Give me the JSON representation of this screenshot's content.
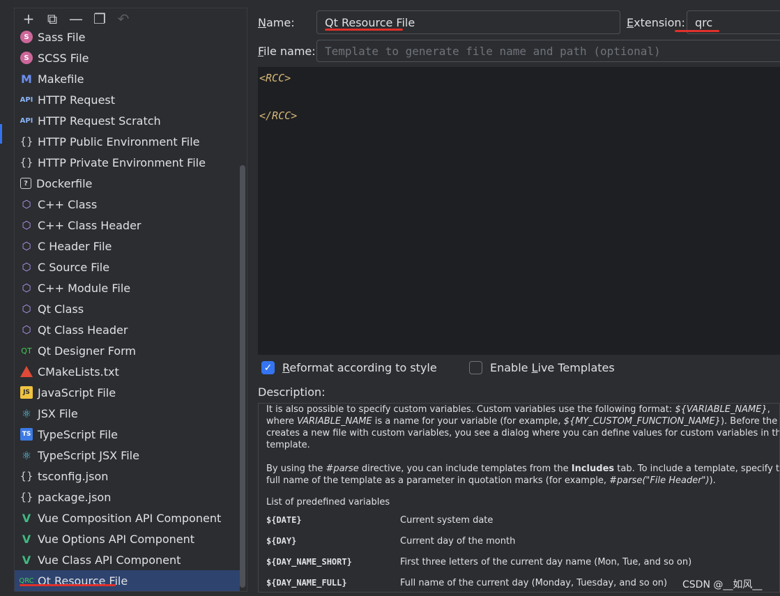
{
  "toolbar": {
    "add": "+",
    "copy": "⧉",
    "remove": "—",
    "duplicate": "❐",
    "undo": "↶"
  },
  "templates": [
    {
      "label": "Sass File",
      "icon": "sass-icon"
    },
    {
      "label": "SCSS File",
      "icon": "sass-icon"
    },
    {
      "label": "Makefile",
      "icon": "makefile-icon"
    },
    {
      "label": "HTTP Request",
      "icon": "api-icon"
    },
    {
      "label": "HTTP Request Scratch",
      "icon": "api-icon"
    },
    {
      "label": "HTTP Public Environment File",
      "icon": "braces-icon"
    },
    {
      "label": "HTTP Private Environment File",
      "icon": "braces-icon"
    },
    {
      "label": "Dockerfile",
      "icon": "dockerfile-icon"
    },
    {
      "label": "C++ Class",
      "icon": "cpp-icon"
    },
    {
      "label": "C++ Class Header",
      "icon": "cpp-icon"
    },
    {
      "label": "C Header File",
      "icon": "cpp-icon"
    },
    {
      "label": "C Source File",
      "icon": "cpp-icon"
    },
    {
      "label": "C++ Module File",
      "icon": "cpp-icon"
    },
    {
      "label": "Qt Class",
      "icon": "cpp-icon"
    },
    {
      "label": "Qt Class Header",
      "icon": "cpp-icon"
    },
    {
      "label": "Qt Designer Form",
      "icon": "qt-icon"
    },
    {
      "label": "CMakeLists.txt",
      "icon": "cmake-icon"
    },
    {
      "label": "JavaScript File",
      "icon": "javascript-icon"
    },
    {
      "label": "JSX File",
      "icon": "react-icon"
    },
    {
      "label": "TypeScript File",
      "icon": "typescript-icon"
    },
    {
      "label": "TypeScript JSX File",
      "icon": "react-icon"
    },
    {
      "label": "tsconfig.json",
      "icon": "braces-icon"
    },
    {
      "label": "package.json",
      "icon": "braces-icon"
    },
    {
      "label": "Vue Composition API Component",
      "icon": "vue-icon"
    },
    {
      "label": "Vue Options API Component",
      "icon": "vue-icon"
    },
    {
      "label": "Vue Class API Component",
      "icon": "vue-icon"
    },
    {
      "label": "Qt Resource File",
      "icon": "qrc-icon",
      "selected": true
    }
  ],
  "icon_glyphs": {
    "sass": "S",
    "makefile": "M",
    "api": "API",
    "braces": "{}",
    "dockerfile": "?",
    "cpp": "⬡",
    "qt": "QT",
    "js": "JS",
    "react": "⚛",
    "ts": "TS",
    "vue": "V",
    "qrc": "QRC"
  },
  "form": {
    "name_label_prefix": "N",
    "name_label_rest": "ame:",
    "name_value": "Qt Resource File",
    "extension_label_prefix": "E",
    "extension_label_rest": "xtension:",
    "extension_value": "qrc",
    "filename_label_prefix": "F",
    "filename_label_rest": "ile name:",
    "filename_placeholder": "Template to generate file name and path (optional)"
  },
  "editor": {
    "lines": [
      "<RCC>",
      "",
      "",
      "</RCC>"
    ]
  },
  "options": {
    "reformat_prefix": "R",
    "reformat_rest": "eformat according to style",
    "reformat_checked": true,
    "live_pre": "Enable ",
    "live_key": "L",
    "live_post": "ive Templates",
    "live_checked": false
  },
  "description": {
    "label": "Description:",
    "p1_a": "It is also possible to specify custom variables. Custom variables use the following format: ",
    "p1_b": "${VARIABLE_NAME}",
    "p1_c": ", where ",
    "p1_d": "VARIABLE_NAME",
    "p1_e": " is a name for your variable (for example, ",
    "p1_f": "${MY_CUSTOM_FUNCTION_NAME}",
    "p1_g": "). Before the IDE creates a new file with custom variables, you see a dialog where you can define values for custom variables in the template.",
    "p2_a": "By using the ",
    "p2_b": "#parse",
    "p2_c": " directive, you can include templates from the ",
    "p2_d": "Includes",
    "p2_e": " tab. To include a template, specify the full name of the template as a parameter in quotation marks (for example, ",
    "p2_f": "#parse(\"File Header\")",
    "p2_g": ").",
    "list_title": "List of predefined variables",
    "variables": [
      {
        "name": "${DATE}",
        "desc": "Current system date"
      },
      {
        "name": "${DAY}",
        "desc": "Current day of the month"
      },
      {
        "name": "${DAY_NAME_SHORT}",
        "desc": "First three letters of the current day name (Mon, Tue, and so on)"
      },
      {
        "name": "${DAY_NAME_FULL}",
        "desc": "Full name of the current day (Monday, Tuesday, and so on)"
      }
    ]
  },
  "watermark": "CSDN @__如风__",
  "colors": {
    "accent": "#3574f0",
    "selection": "#2e436e",
    "annotation_red": "#e0302b",
    "xml_tag": "#d5b778"
  }
}
